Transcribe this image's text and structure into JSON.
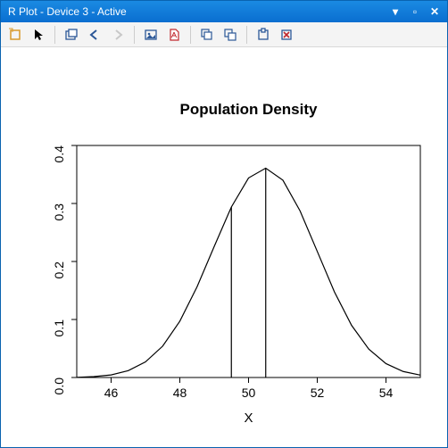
{
  "window": {
    "title": "R Plot - Device 3 - Active"
  },
  "toolbar": {
    "new_window": "new-window",
    "select": "select",
    "copy": "copy",
    "back": "back",
    "forward": "forward",
    "png": "png-export",
    "pdf": "pdf-export",
    "cascade": "cascade-windows",
    "tile": "tile-windows",
    "fit": "fit-window",
    "close_dev": "close-device"
  },
  "chart_data": {
    "type": "line",
    "title": "Population Density",
    "xlabel": "X",
    "ylabel": "",
    "xlim": [
      45,
      55
    ],
    "ylim": [
      0.0,
      0.4
    ],
    "xticks": [
      46,
      48,
      50,
      52,
      54
    ],
    "yticks": [
      0.0,
      0.1,
      0.2,
      0.3,
      0.4
    ],
    "series": [
      {
        "name": "density",
        "x": [
          45,
          45.5,
          46,
          46.5,
          47,
          47.5,
          48,
          48.5,
          49,
          49.5,
          50,
          50.5,
          51,
          51.5,
          52,
          52.5,
          53,
          53.5,
          54,
          54.5,
          55
        ],
        "values": [
          0.0003,
          0.0015,
          0.0044,
          0.0118,
          0.0269,
          0.054,
          0.097,
          0.1562,
          0.2258,
          0.2939,
          0.344,
          0.3609,
          0.3401,
          0.2871,
          0.2174,
          0.1475,
          0.0898,
          0.0489,
          0.0239,
          0.0104,
          0.0041
        ]
      }
    ],
    "annotations": {
      "vlines_x": [
        49.5,
        50.5
      ],
      "vline_from_y": 0.0,
      "vline_to_curve": true
    }
  }
}
